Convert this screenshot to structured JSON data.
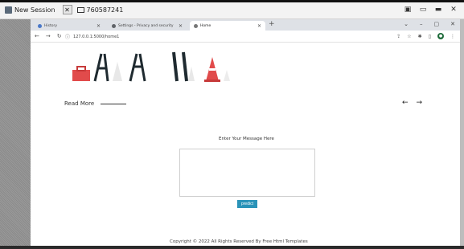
{
  "session": {
    "title": "New Session",
    "connection_id": "760587241"
  },
  "browser": {
    "tabs": [
      {
        "label": "History",
        "active": false
      },
      {
        "label": "Settings - Privacy and security",
        "active": false
      },
      {
        "label": "Home",
        "active": true
      }
    ],
    "address": "127.0.0.1:5000/home1"
  },
  "page": {
    "read_more": "Read More",
    "prev_arrow": "←",
    "next_arrow": "→",
    "message_label": "Enter Your Message Here",
    "message_value": "",
    "predict_label": "predict",
    "footer": "Copyright © 2022 All Rights Reserved By Free Html Templates"
  },
  "colors": {
    "accent": "#2a93b8",
    "product_red": "#e14b4b",
    "product_dark": "#1f2a30"
  }
}
